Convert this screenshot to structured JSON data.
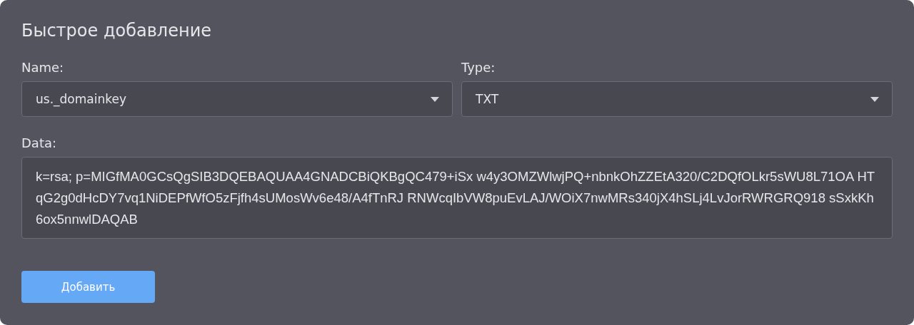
{
  "title": "Быстрое добавление",
  "name_field": {
    "label": "Name:",
    "value": "us._domainkey"
  },
  "type_field": {
    "label": "Type:",
    "value": "TXT"
  },
  "data_field": {
    "label": "Data:",
    "value": "k=rsa; p=MIGfMA0GCsQgSIB3DQEBAQUAA4GNADCBiQKBgQC479+iSx w4y3OMZWlwjPQ+nbnkOhZZEtA320/C2DQfOLkr5sWU8L71OA HTqG2g0dHcDY7vq1NiDEPfWfO5zFjfh4sUMosWv6e48/A4fTnRJ RNWcqIbVW8puEvLAJ/WOiX7nwMRs340jX4hSLj4LvJorRWRGRQ918 sSxkKh6ox5nnwlDAQAB"
  },
  "submit_button": "Добавить"
}
